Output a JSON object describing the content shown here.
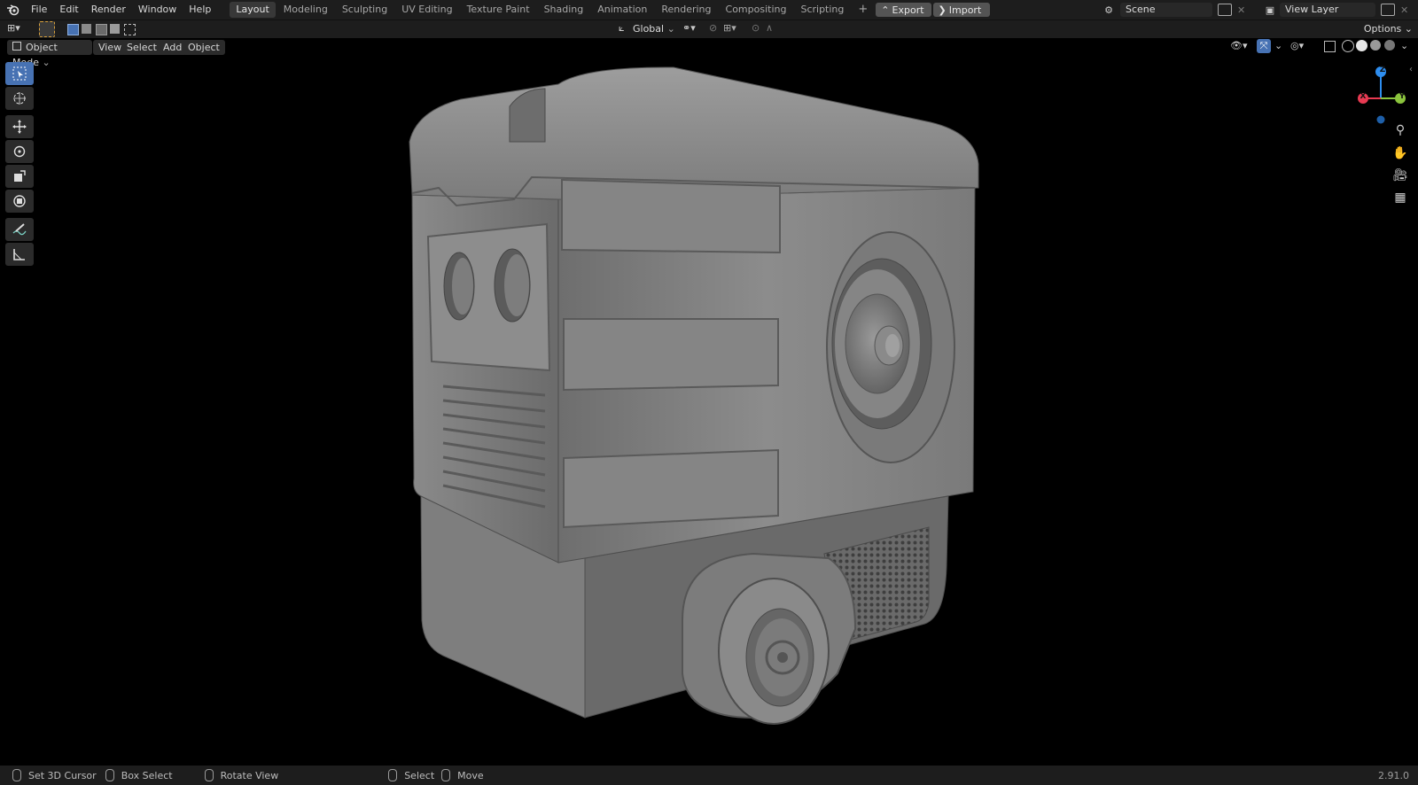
{
  "topbar": {
    "menus": [
      "File",
      "Edit",
      "Render",
      "Window",
      "Help"
    ],
    "workspaces": [
      "Layout",
      "Modeling",
      "Sculpting",
      "UV Editing",
      "Texture Paint",
      "Shading",
      "Animation",
      "Rendering",
      "Compositing",
      "Scripting"
    ],
    "active_workspace": "Layout",
    "add_tab": "+",
    "export_label": "Export",
    "import_label": "Import",
    "scene_value": "Scene",
    "view_layer_value": "View Layer"
  },
  "header": {
    "transform_orientation": "Global",
    "options_label": "Options"
  },
  "viewport_header": {
    "mode": "Object Mode",
    "menus": [
      "View",
      "Select",
      "Add",
      "Object"
    ]
  },
  "gizmo": {
    "z_label": "Z",
    "x_label": "X",
    "y_label": "Y"
  },
  "statusbar": {
    "items": [
      "Set 3D Cursor",
      "Box Select",
      "Rotate View",
      "Select",
      "Move"
    ],
    "version": "2.91.0"
  },
  "colors": {
    "accent": "#4772b3",
    "axis_x": "#e83a52",
    "axis_y": "#8bc43d",
    "axis_z": "#2e8ef0",
    "model_gray": "#8e8e8e"
  }
}
